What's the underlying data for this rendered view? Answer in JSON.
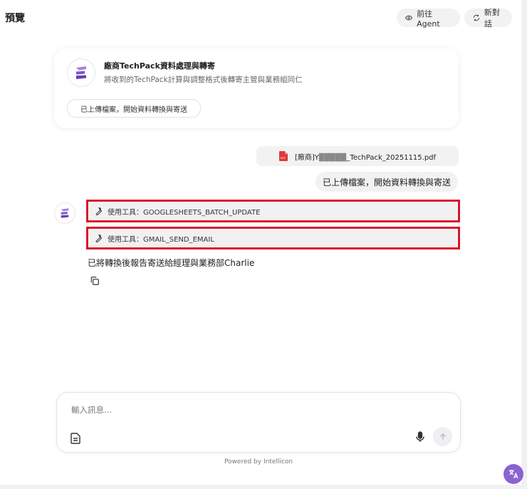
{
  "header": {
    "title": "預覽",
    "agent_button_label": "前往 Agent",
    "new_chat_button_label": "新對話"
  },
  "intro_card": {
    "title": "廠商TechPack資料處理與轉寄",
    "description": "將收到的TechPack計算與調整格式後轉寄主管與業務組同仁",
    "suggestion": "已上傳檔案，開始資料轉換與寄送"
  },
  "conversation": {
    "file_name": "[廠商]Y▒▒▒▒▒_TechPack_20251115.pdf",
    "user_message": "已上傳檔案，開始資料轉換與寄送",
    "tool_calls": [
      {
        "label": "使用工具：GOOGLESHEETS_BATCH_UPDATE"
      },
      {
        "label": "使用工具：GMAIL_SEND_EMAIL"
      }
    ],
    "bot_message": "已將轉換後報告寄送給經理與業務部Charlie"
  },
  "composer": {
    "placeholder": "輸入訊息..."
  },
  "footer": {
    "powered_by": "Powered by Intellicon"
  },
  "colors": {
    "highlight_border": "#d8132a",
    "brand_purple": "#8a63d2",
    "bubble_bg": "#f2f2f3",
    "pdf_red": "#e03a3a"
  },
  "icons": {
    "agent_button": "eye-icon",
    "new_chat_button": "refresh-icon",
    "tool": "wrench-icon",
    "file": "pdf-file-icon",
    "copy": "copy-icon",
    "attach": "document-icon",
    "mic": "microphone-icon",
    "send": "arrow-up-icon",
    "fab": "translate-icon"
  }
}
